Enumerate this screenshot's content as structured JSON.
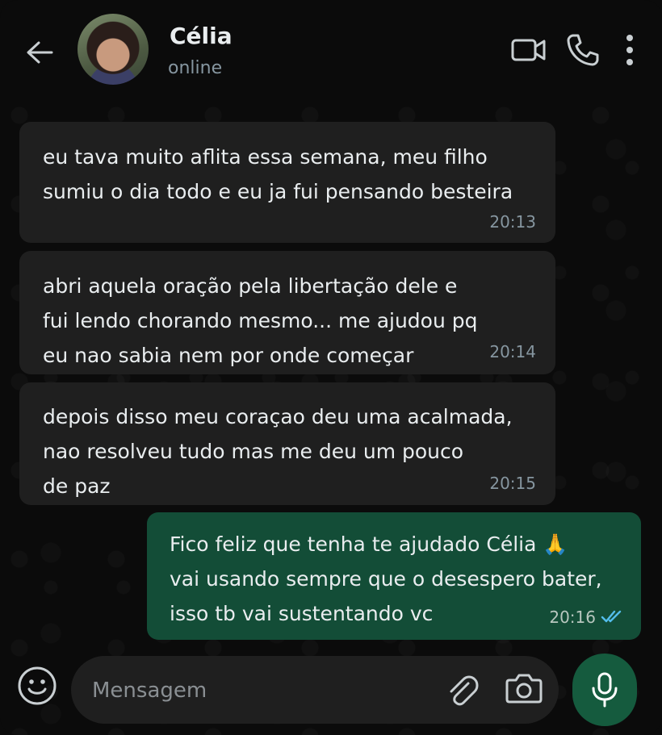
{
  "header": {
    "contact_name": "Célia",
    "status": "online",
    "icons": {
      "back": "arrow-left-icon",
      "video": "video-camera-icon",
      "call": "phone-icon",
      "menu": "more-vertical-icon"
    }
  },
  "messages": [
    {
      "direction": "incoming",
      "text": "eu tava muito aflita essa semana, meu filho\nsumiu o dia todo e eu ja fui pensando besteira",
      "time": "20:13"
    },
    {
      "direction": "incoming",
      "text": "abri aquela oração pela libertação dele e\nfui lendo chorando mesmo... me ajudou pq\neu nao sabia nem por onde começar",
      "time": "20:14"
    },
    {
      "direction": "incoming",
      "text": "depois disso meu coraçao deu uma acalmada,\nnao resolveu tudo mas me deu um pouco\nde paz",
      "time": "20:15"
    },
    {
      "direction": "outgoing",
      "text": "Fico feliz que tenha te ajudado Célia 🙏\nvai usando sempre que o desespero bater,\nisso tb vai sustentando vc",
      "time": "20:16",
      "read_status": "read"
    }
  ],
  "composer": {
    "placeholder": "Mensagem",
    "icons": {
      "emoji": "emoji-icon",
      "attach": "paperclip-icon",
      "camera": "camera-icon",
      "mic": "microphone-icon"
    }
  },
  "colors": {
    "background": "#0b0b0b",
    "incoming_bubble": "#1f1f1f",
    "outgoing_bubble": "#134d37",
    "accent_green": "#155b3e",
    "read_ticks": "#53bdeb",
    "muted_text": "#8696a0"
  }
}
